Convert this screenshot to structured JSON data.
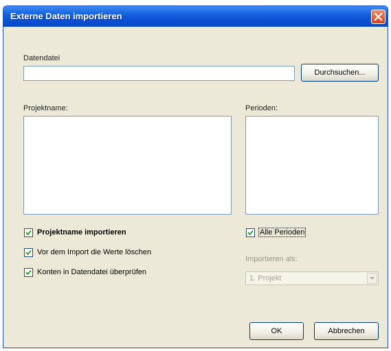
{
  "window": {
    "title": "Externe Daten importieren"
  },
  "file_section": {
    "label": "Datendatei",
    "value": "",
    "browse_label": "Durchsuchen..."
  },
  "projects": {
    "label": "Projektname:",
    "items": []
  },
  "periods": {
    "label": "Perioden:",
    "items": []
  },
  "options": {
    "import_project_name": {
      "label": "Projektname importieren",
      "checked": true
    },
    "delete_values": {
      "label": "Vor dem Import die Werte löschen",
      "checked": true
    },
    "check_accounts": {
      "label": "Konten in Datendatei überprüfen",
      "checked": true
    },
    "all_periods": {
      "label": "Alle Perioden",
      "checked": true
    }
  },
  "import_as": {
    "label": "Importieren als:",
    "selected": "1. Projekt",
    "enabled": false
  },
  "buttons": {
    "ok_label": "OK",
    "cancel_label": "Abbrechen"
  },
  "colors": {
    "titlebar": "#0b4fd3",
    "dialog_bg": "#ece9d8",
    "close_button": "#d2411c"
  }
}
